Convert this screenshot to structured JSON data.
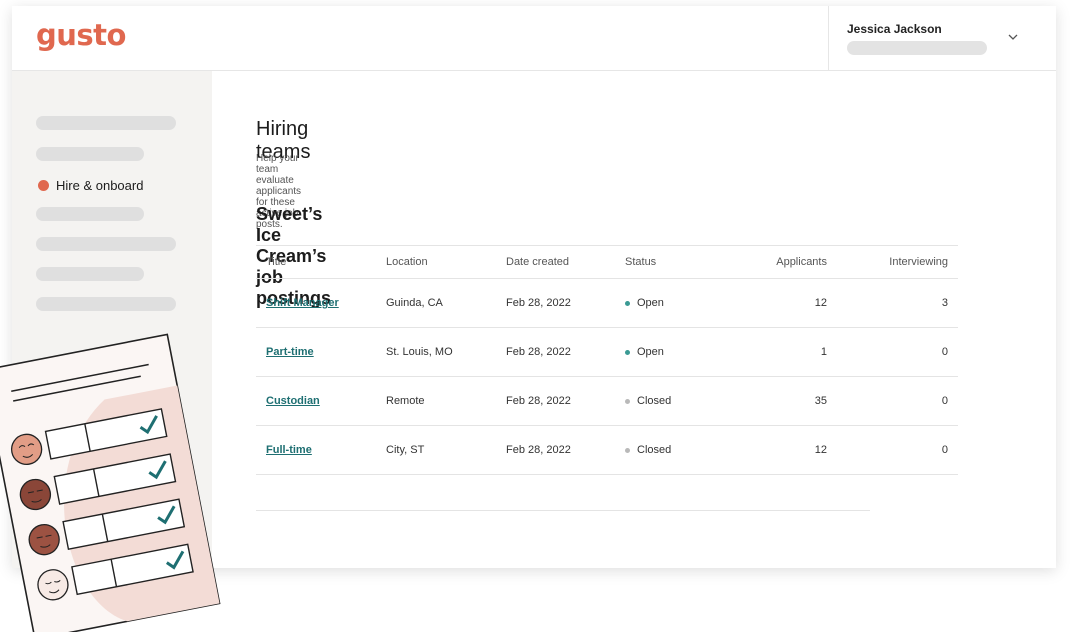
{
  "app": {
    "logo": "gusto"
  },
  "user": {
    "name": "Jessica Jackson"
  },
  "sidebar": {
    "active_item": {
      "label": "Hire & onboard"
    }
  },
  "page": {
    "title": "Hiring teams",
    "subtitle": "Help your team evaluate applicants for these active job posts.",
    "section_title": "Sweet’s Ice Cream’s job postings"
  },
  "table": {
    "columns": [
      "Title",
      "Location",
      "Date created",
      "Status",
      "Applicants",
      "Interviewing"
    ],
    "rows": [
      {
        "title": "Shift Manager",
        "location": "Guinda, CA",
        "date": "Feb 28, 2022",
        "status": "Open",
        "applicants": "12",
        "interviewing": "3"
      },
      {
        "title": "Part-time",
        "location": "St. Louis, MO",
        "date": "Feb 28, 2022",
        "status": "Open",
        "applicants": "1",
        "interviewing": "0"
      },
      {
        "title": "Custodian",
        "location": "Remote",
        "date": "Feb 28, 2022",
        "status": "Closed",
        "applicants": "35",
        "interviewing": "0"
      },
      {
        "title": "Full-time",
        "location": "City, ST",
        "date": "Feb 28, 2022",
        "status": "Closed",
        "applicants": "12",
        "interviewing": "0"
      }
    ]
  },
  "colors": {
    "brand": "#e0684f",
    "link": "#1e6f72",
    "status_open": "#3a9a94",
    "status_closed": "#b9b9b9"
  },
  "icons": {
    "user_menu": "chevron-down-icon"
  }
}
